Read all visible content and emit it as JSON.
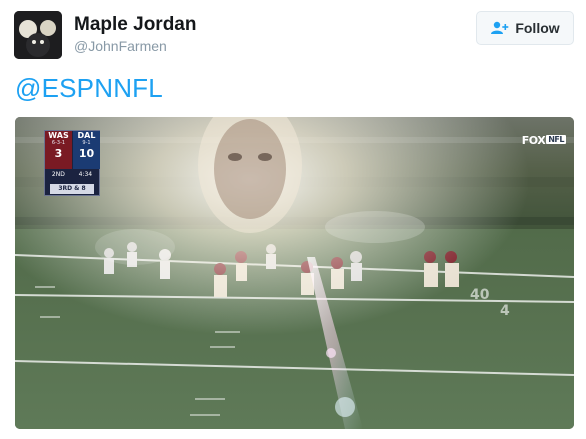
{
  "user": {
    "display_name": "Maple Jordan",
    "handle": "@JohnFarmen"
  },
  "follow_button": {
    "label": "Follow",
    "icon": "add-user-icon"
  },
  "tweet": {
    "text": "@ESPNNFL"
  },
  "media": {
    "scorebug": {
      "away_team": "WAS",
      "away_record": "6-3-1",
      "away_score": "3",
      "home_team": "DAL",
      "home_record": "9-1",
      "home_score": "10",
      "quarter": "2ND",
      "clock": "4:34",
      "down_distance": "3RD & 8"
    },
    "network_logo": {
      "fox": "FOX",
      "nfl": "NFL"
    }
  },
  "colors": {
    "link": "#1da1f2",
    "name": "#14171a",
    "handle": "#8899a6",
    "follow_bg": "#f5f8fa",
    "was_red": "#7a1a23",
    "dal_blue": "#1b3b73"
  }
}
